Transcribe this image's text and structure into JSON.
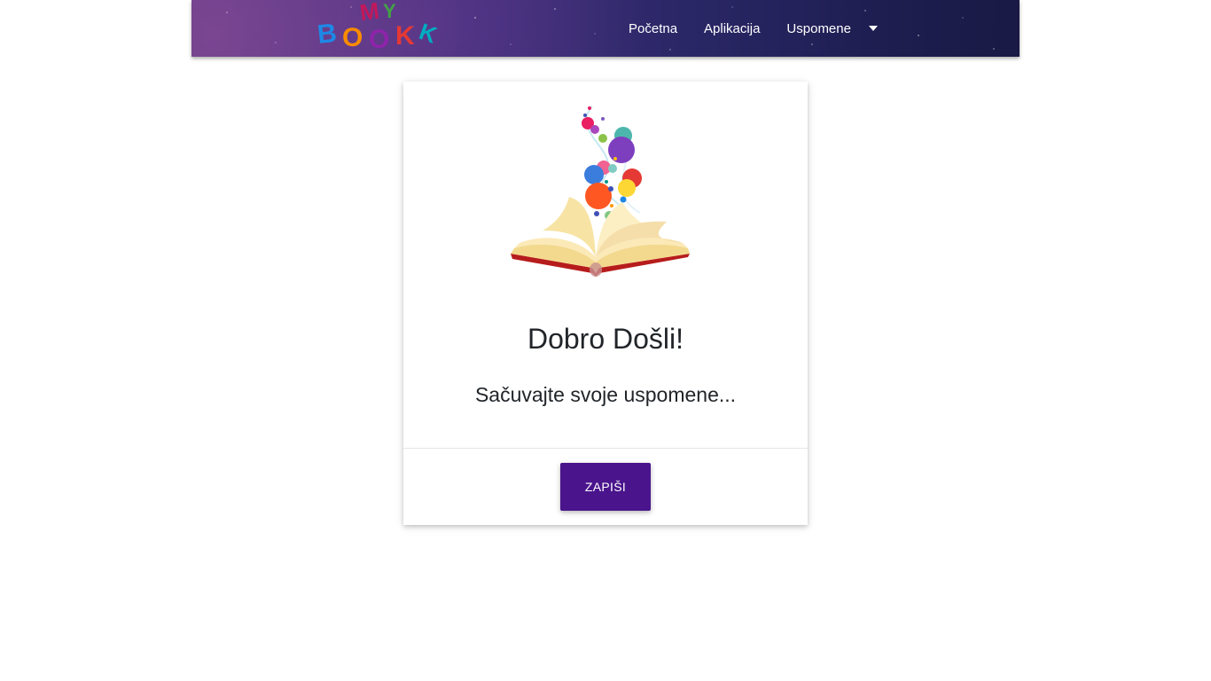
{
  "navbar": {
    "logo_icon": "mybook-logo-icon",
    "links": [
      {
        "label": "Početna"
      },
      {
        "label": "Aplikacija"
      }
    ],
    "dropdown": {
      "label": "Uspomene",
      "icon": "caret-down-icon"
    },
    "background_colors": [
      "#5b3a82",
      "#2a2766",
      "#1a1a45"
    ]
  },
  "card": {
    "image_icon": "open-book-bubbles-illustration",
    "title": "Dobro Došli!",
    "text": "Sačuvajte svoje uspomene...",
    "button_label": "ZAPIŠI",
    "button_color": "#4a148c"
  }
}
